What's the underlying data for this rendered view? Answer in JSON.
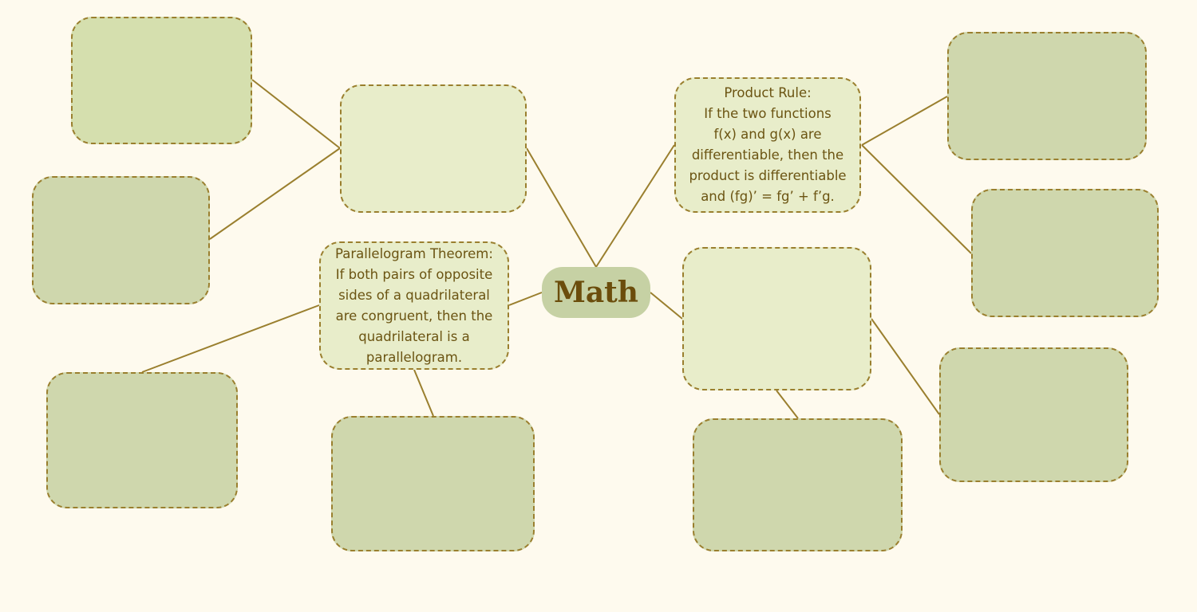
{
  "center": {
    "title": "Math"
  },
  "nodes": {
    "product_rule": "Product Rule:\nIf the two functions\nf(x) and g(x) are\ndifferentiable, then the\nproduct is differentiable\nand (fg)’ = fg’ + f’g.",
    "parallelogram_theorem": "Parallelogram Theorem:\nIf both pairs of opposite\nsides of a quadrilateral\nare congruent, then the\nquadrilateral is a\nparallelogram."
  },
  "colors": {
    "background": "#fefaee",
    "connector": "#9a7f2e",
    "center_fill": "#c6d1a4",
    "center_text": "#6b4d0c",
    "node_light": "#e8edca",
    "node_dark": "#cfd7ad",
    "node_text": "#6b5412"
  }
}
